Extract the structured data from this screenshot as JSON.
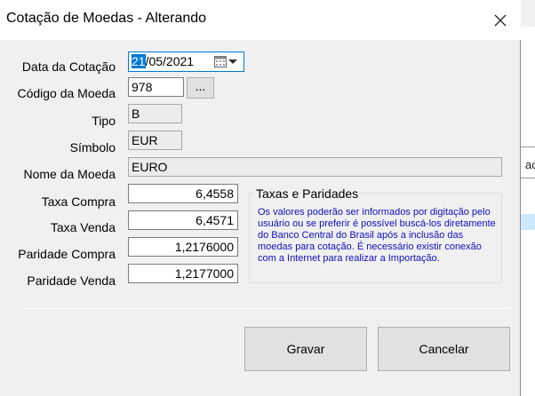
{
  "window": {
    "title": "Cotação de Moedas - Alterando"
  },
  "labels": {
    "data_cotacao": "Data da Cotação",
    "codigo_moeda": "Código da Moeda",
    "tipo": "Tipo",
    "simbolo": "Símbolo",
    "nome_moeda": "Nome da Moeda",
    "taxa_compra": "Taxa Compra",
    "taxa_venda": "Taxa Venda",
    "paridade_compra": "Paridade Compra",
    "paridade_venda": "Paridade Venda"
  },
  "fields": {
    "data_day": "21",
    "data_rest": "/05/2021",
    "codigo_moeda": "978",
    "tipo": "B",
    "simbolo": "EUR",
    "nome_moeda": "EURO",
    "taxa_compra": "6,4558",
    "taxa_venda": "6,4571",
    "paridade_compra": "1,2176000",
    "paridade_venda": "1,2177000"
  },
  "lookup_button": "...",
  "group": {
    "title": "Taxas e Paridades",
    "text": "Os valores poderão ser informados por digitação pelo usuário ou se preferir é possível buscá-los diretamente do Banco Central do Brasil após a inclusão das moedas para cotação. É necessário existir conexão com a Internet para realizar a Importação."
  },
  "buttons": {
    "save": "Gravar",
    "cancel": "Cancelar"
  },
  "background": {
    "partial_text": "ac"
  },
  "colors": {
    "accent": "#0078d7",
    "info_text": "#1010c0"
  }
}
